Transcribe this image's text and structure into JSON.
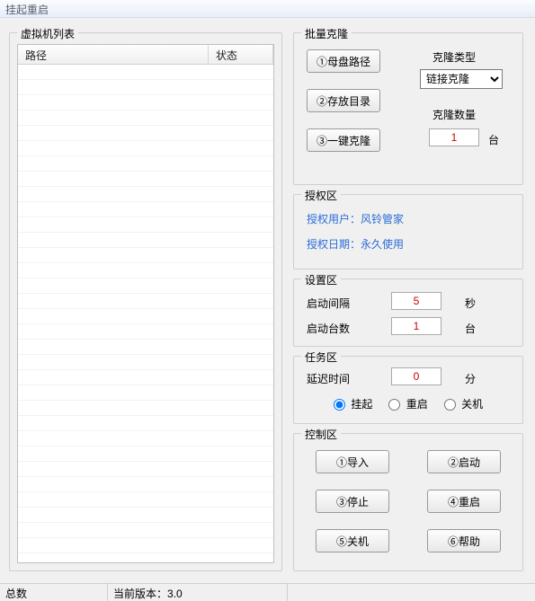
{
  "window": {
    "title": "挂起重启"
  },
  "vmlist": {
    "legend": "虚拟机列表",
    "columns": {
      "path": "路径",
      "status": "状态"
    }
  },
  "clone": {
    "legend": "批量克隆",
    "btn_parentpath": "①母盘路径",
    "btn_savedir": "②存放目录",
    "btn_oneclick": "③一键克隆",
    "type_label": "克隆类型",
    "type_selected": "链接克隆",
    "type_options": [
      "链接克隆"
    ],
    "count_label": "克隆数量",
    "count_value": "1",
    "count_unit": "台"
  },
  "auth": {
    "legend": "授权区",
    "user_label": "授权用户：",
    "user_value": "风铃管家",
    "date_label": "授权日期：",
    "date_value": "永久使用"
  },
  "settings": {
    "legend": "设置区",
    "interval_label": "启动间隔",
    "interval_value": "5",
    "interval_unit": "秒",
    "count_label": "启动台数",
    "count_value": "1",
    "count_unit": "台"
  },
  "task": {
    "legend": "任务区",
    "delay_label": "延迟时间",
    "delay_value": "0",
    "delay_unit": "分",
    "radio_suspend": "挂起",
    "radio_restart": "重启",
    "radio_shutdown": "关机",
    "selected": "suspend"
  },
  "control": {
    "legend": "控制区",
    "btn_import": "①导入",
    "btn_start": "②启动",
    "btn_stop": "③停止",
    "btn_restart": "④重启",
    "btn_poweroff": "⑤关机",
    "btn_help": "⑥帮助"
  },
  "status": {
    "total_label": "总数",
    "version_label": "当前版本：",
    "version_value": "3.0"
  }
}
